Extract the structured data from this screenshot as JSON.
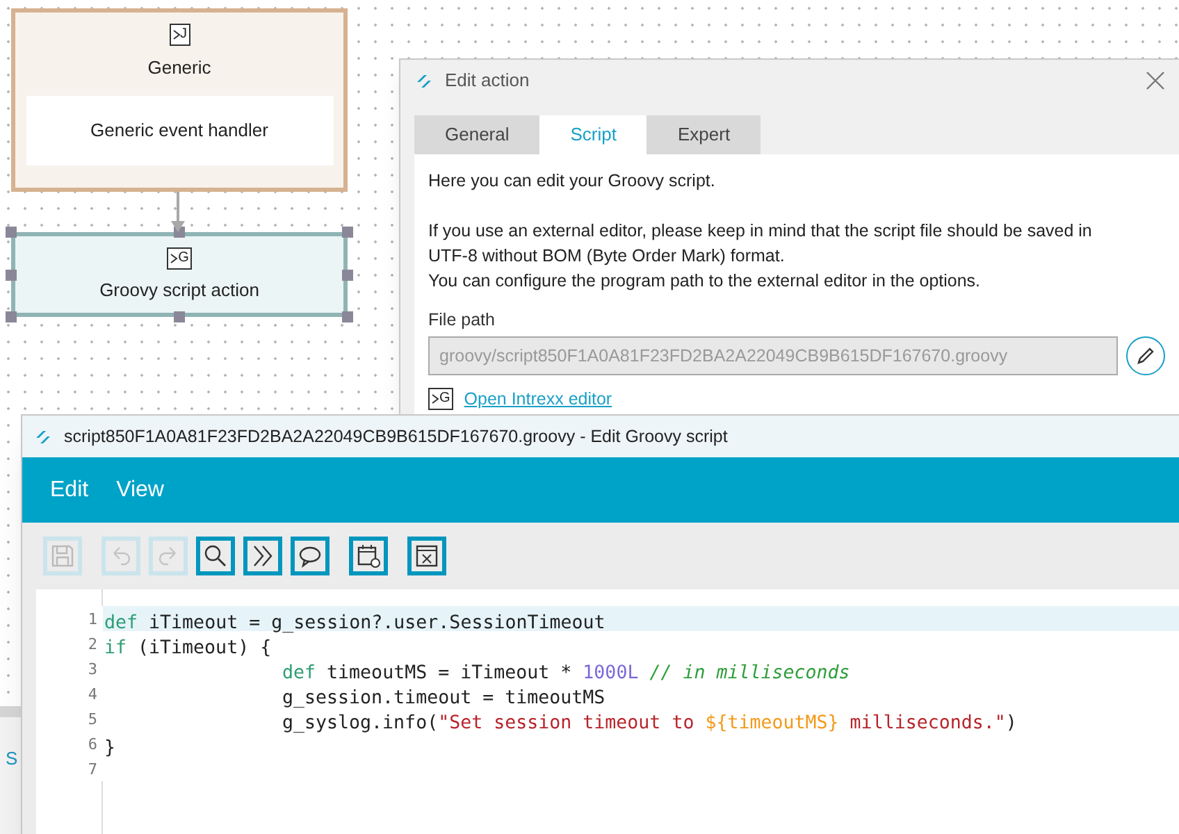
{
  "canvas": {
    "nodes": [
      {
        "kind": "event",
        "badge": "J",
        "title": "Generic",
        "subtitle": "Generic event handler",
        "selected": false
      },
      {
        "kind": "action",
        "badge": "G",
        "title": "Groovy script action",
        "selected": true
      }
    ]
  },
  "behind_panel": {
    "text": "S"
  },
  "dialog": {
    "title": "Edit action",
    "tabs": [
      {
        "label": "General",
        "selected": false
      },
      {
        "label": "Script",
        "selected": true
      },
      {
        "label": "Expert",
        "selected": false
      }
    ],
    "paragraphs": [
      [
        "Here you can edit your Groovy script."
      ],
      [
        "If you use an external editor, please keep in mind that the script file should be saved in",
        "UTF-8 without BOM (Byte Order Mark) format.",
        "You can configure the program path to the external editor in the options."
      ]
    ],
    "file_path": {
      "label": "File path",
      "value": "groovy/script850F1A0A81F23FD2BA2A22049CB9B615DF167670.groovy"
    },
    "link": {
      "badge": "G",
      "text": "Open Intrexx editor"
    }
  },
  "editor": {
    "title": "script850F1A0A81F23FD2BA2A22049CB9B615DF167670.groovy - Edit Groovy script",
    "menus": [
      "Edit",
      "View"
    ],
    "toolbar": [
      [
        {
          "kind": "save",
          "disabled": true
        }
      ],
      [
        {
          "kind": "undo",
          "disabled": true
        },
        {
          "kind": "redo",
          "disabled": true
        },
        {
          "kind": "search",
          "disabled": false
        },
        {
          "kind": "goto",
          "disabled": false
        },
        {
          "kind": "comment",
          "disabled": false
        }
      ],
      [
        {
          "kind": "calendar",
          "disabled": false
        }
      ],
      [
        {
          "kind": "fullscreen",
          "disabled": false
        }
      ]
    ],
    "lines": [
      {
        "number": "1",
        "highlighted": true,
        "indented": false,
        "tokens": [
          {
            "kind": "keyword",
            "text": "def"
          },
          {
            "kind": "plain",
            "text": " iTimeout = g_session?.user.SessionTimeout"
          }
        ]
      },
      {
        "number": "2",
        "highlighted": false,
        "indented": false,
        "tokens": [
          {
            "kind": "keyword",
            "text": "if"
          },
          {
            "kind": "plain",
            "text": " (iTimeout) {"
          }
        ]
      },
      {
        "number": "3",
        "highlighted": false,
        "indented": true,
        "tokens": [
          {
            "kind": "keyword",
            "text": "def"
          },
          {
            "kind": "plain",
            "text": " timeoutMS = iTimeout * "
          },
          {
            "kind": "number",
            "text": "1000L"
          },
          {
            "kind": "comment",
            "text": " // in milliseconds"
          }
        ]
      },
      {
        "number": "4",
        "highlighted": false,
        "indented": true,
        "tokens": [
          {
            "kind": "plain",
            "text": "g_session.timeout = timeoutMS"
          }
        ]
      },
      {
        "number": "5",
        "highlighted": false,
        "indented": true,
        "tokens": [
          {
            "kind": "plain",
            "text": "g_syslog.info("
          },
          {
            "kind": "string",
            "text": "\"Set session timeout to "
          },
          {
            "kind": "interpolation",
            "text": "${timeoutMS}"
          },
          {
            "kind": "string",
            "text": " milliseconds.\""
          },
          {
            "kind": "plain",
            "text": ")"
          }
        ]
      },
      {
        "number": "6",
        "highlighted": false,
        "indented": false,
        "tokens": [
          {
            "kind": "plain",
            "text": "}"
          }
        ]
      },
      {
        "number": "7",
        "highlighted": false
      }
    ]
  }
}
